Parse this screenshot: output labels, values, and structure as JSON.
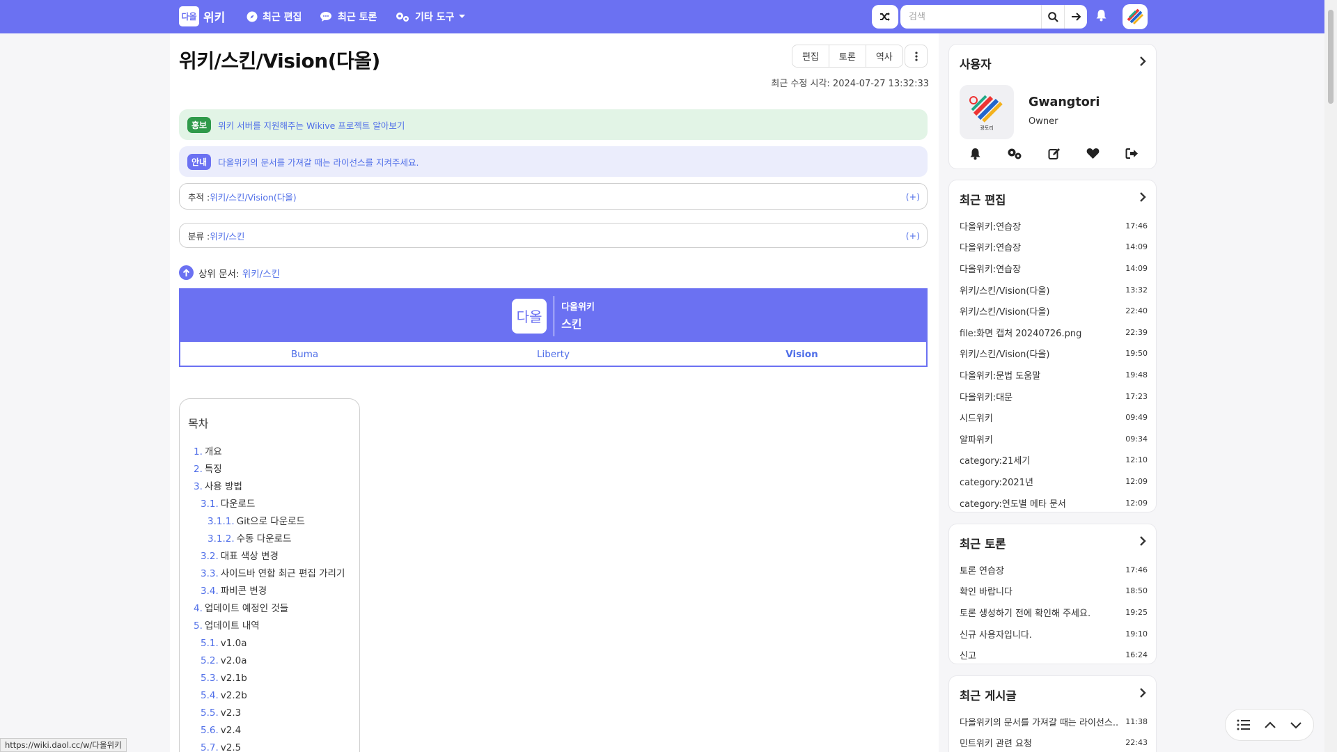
{
  "nav": {
    "logo_text": "다올",
    "brand": "위키",
    "links": [
      {
        "label": "최근 편집",
        "icon": "compass-icon"
      },
      {
        "label": "최근 토론",
        "icon": "comments-icon"
      },
      {
        "label": "기타 도구",
        "icon": "gears-icon"
      }
    ],
    "search_placeholder": "검색"
  },
  "page": {
    "title": "위키/스킨/Vision(다올)",
    "actions": [
      "편집",
      "토론",
      "역사"
    ],
    "modified": "최근 수정 시각: 2024-07-27 13:32:33"
  },
  "notices": [
    {
      "badge": "홍보",
      "text": "위키 서버를 지원해주는 Wikive 프로젝트 알아보기"
    },
    {
      "badge": "안내",
      "text": "다올위키의 문서를 가져갈 때는 라이선스를 지켜주세요."
    }
  ],
  "trace": {
    "label": "추적 : ",
    "link": "위키/스킨/Vision(다올)",
    "plus": "(+)"
  },
  "category": {
    "label": "분류 : ",
    "link": "위키/스킨",
    "plus": "(+)"
  },
  "parent": {
    "label": "상위 문서: ",
    "link": "위키/스킨"
  },
  "skin_nav": {
    "logo": "다올",
    "line1": "다올위키",
    "line2": "스킨",
    "tabs": [
      "Buma",
      "Liberty",
      "Vision"
    ],
    "active_tab": "Vision"
  },
  "toc": {
    "title": "목차",
    "items": [
      {
        "num": "1.",
        "text": "개요",
        "level": 1
      },
      {
        "num": "2.",
        "text": "특징",
        "level": 1
      },
      {
        "num": "3.",
        "text": "사용 방법",
        "level": 1
      },
      {
        "num": "3.1.",
        "text": "다운로드",
        "level": 2
      },
      {
        "num": "3.1.1.",
        "text": "Git으로 다운로드",
        "level": 3
      },
      {
        "num": "3.1.2.",
        "text": "수동 다운로드",
        "level": 3
      },
      {
        "num": "3.2.",
        "text": "대표 색상 변경",
        "level": 2
      },
      {
        "num": "3.3.",
        "text": "사이드바 연합 최근 편집 가리기",
        "level": 2
      },
      {
        "num": "3.4.",
        "text": "파비콘 변경",
        "level": 2
      },
      {
        "num": "4.",
        "text": "업데이트 예정인 것들",
        "level": 1
      },
      {
        "num": "5.",
        "text": "업데이트 내역",
        "level": 1
      },
      {
        "num": "5.1.",
        "text": "v1.0a",
        "level": 2
      },
      {
        "num": "5.2.",
        "text": "v2.0a",
        "level": 2
      },
      {
        "num": "5.3.",
        "text": "v2.1b",
        "level": 2
      },
      {
        "num": "5.4.",
        "text": "v2.2b",
        "level": 2
      },
      {
        "num": "5.5.",
        "text": "v2.3",
        "level": 2
      },
      {
        "num": "5.6.",
        "text": "v2.4",
        "level": 2
      },
      {
        "num": "5.7.",
        "text": "v2.5",
        "level": 2
      }
    ]
  },
  "sidebar": {
    "user": {
      "title": "사용자",
      "name": "Gwangtori",
      "role": "Owner",
      "avatar_caption": "광토리"
    },
    "recent_changes": {
      "title": "최근 편집",
      "items": [
        {
          "t": "다올위키:연습장",
          "tm": "17:46"
        },
        {
          "t": "다올위키:연습장",
          "tm": "14:09"
        },
        {
          "t": "다올위키:연습장",
          "tm": "14:09"
        },
        {
          "t": "위키/스킨/Vision(다올)",
          "tm": "13:32"
        },
        {
          "t": "위키/스킨/Vision(다올)",
          "tm": "22:40"
        },
        {
          "t": "file:화면 캡처 20240726.png",
          "tm": "22:39"
        },
        {
          "t": "위키/스킨/Vision(다올)",
          "tm": "19:50"
        },
        {
          "t": "다올위키:문법 도움말",
          "tm": "19:48"
        },
        {
          "t": "다올위키:대문",
          "tm": "17:23"
        },
        {
          "t": "시드위키",
          "tm": "09:49"
        },
        {
          "t": "알파위키",
          "tm": "09:34"
        },
        {
          "t": "category:21세기",
          "tm": "12:10"
        },
        {
          "t": "category:2021년",
          "tm": "12:09"
        },
        {
          "t": "category:연도별 메타 문서",
          "tm": "12:09"
        }
      ]
    },
    "recent_discuss": {
      "title": "최근 토론",
      "items": [
        {
          "t": "토론 연습장",
          "tm": "17:46"
        },
        {
          "t": "확인 바랍니다",
          "tm": "18:50"
        },
        {
          "t": "토론 생성하기 전에 확인해 주세요.",
          "tm": "19:25"
        },
        {
          "t": "신규 사용자입니다.",
          "tm": "19:10"
        },
        {
          "t": "신고",
          "tm": "16:24"
        }
      ]
    },
    "recent_posts": {
      "title": "최근 게시글",
      "items": [
        {
          "t": "다올위키의 문서를 가져갈 때는 라이선스...",
          "tm": "11:38"
        },
        {
          "t": "민트위키 관련 요청",
          "tm": "22:43"
        }
      ]
    }
  },
  "status_url": "https://wiki.daol.cc/w/다올위키",
  "colors": {
    "primary": "#6b71f2",
    "link": "#4f6ee8",
    "promo_bg": "#e2f4e6",
    "info_bg": "#ebedfc"
  }
}
